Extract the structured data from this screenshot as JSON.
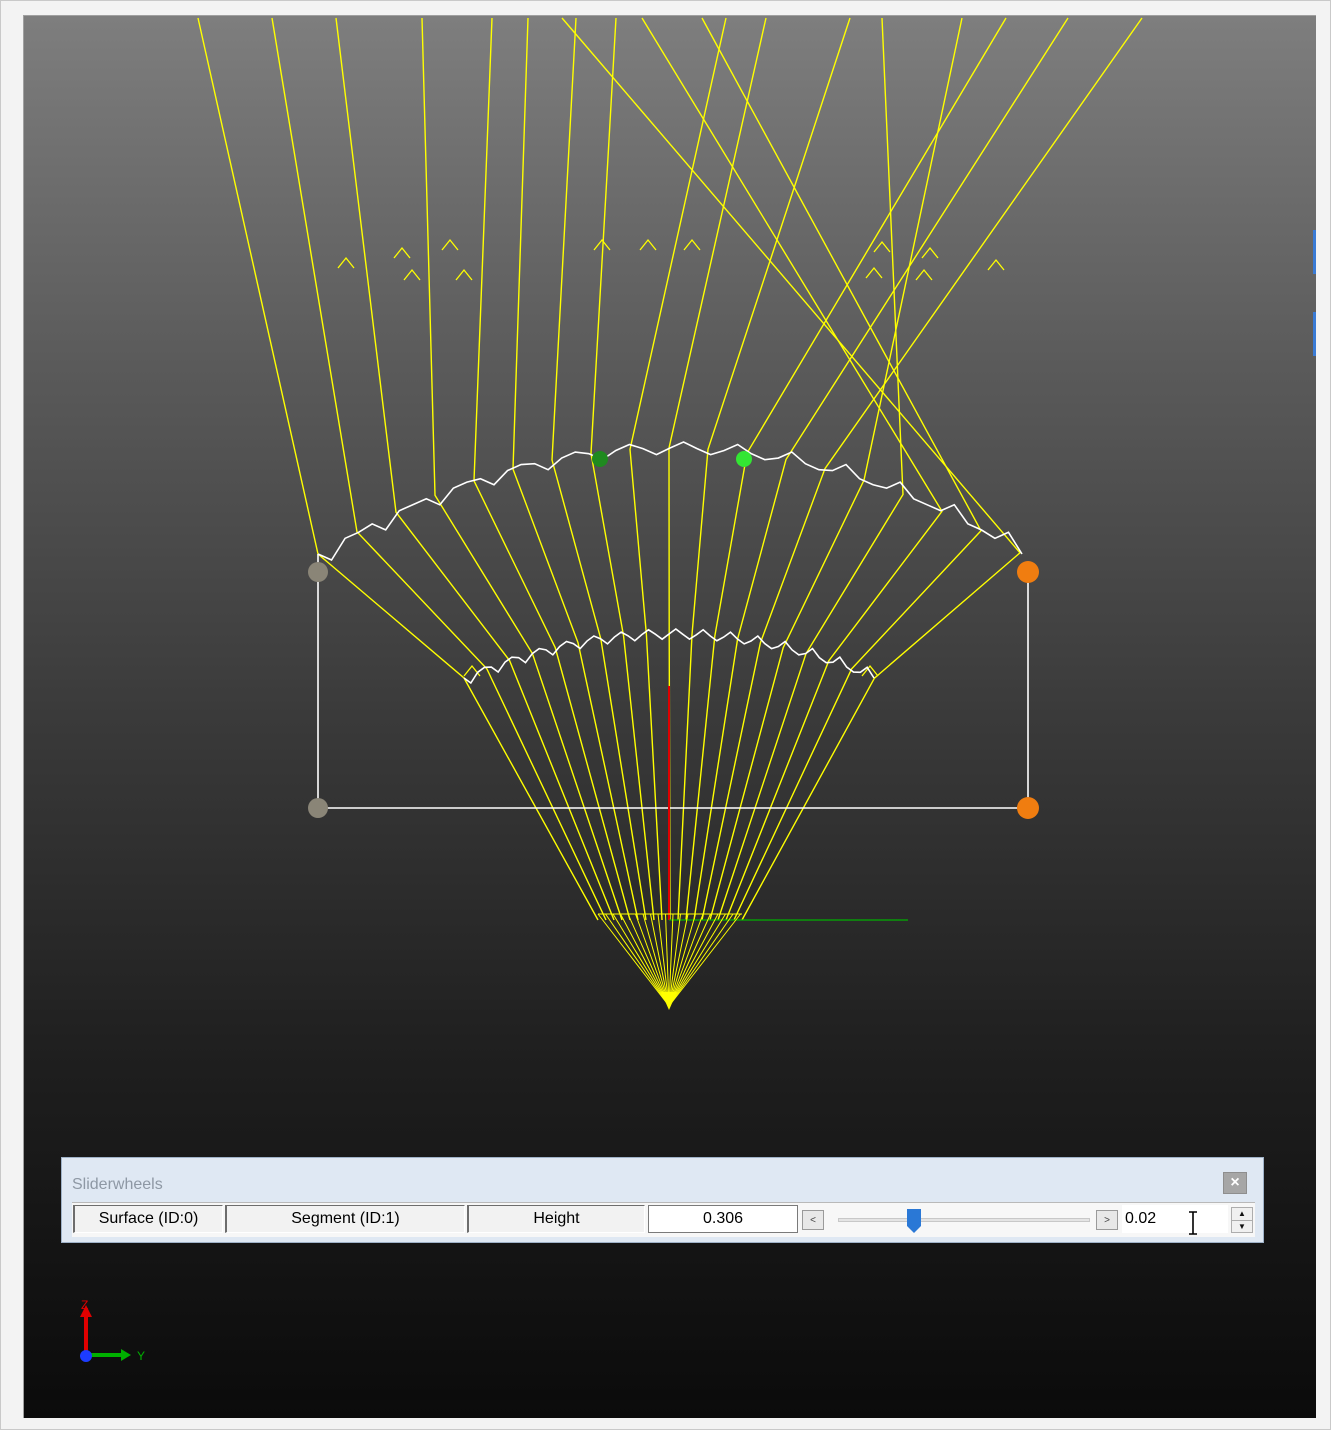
{
  "sliderwheels": {
    "title": "Sliderwheels",
    "close_glyph": "×",
    "surface_label": "Surface (ID:0)",
    "segment_label": "Segment (ID:1)",
    "property_label": "Height",
    "value": "0.306",
    "decrement_glyph": "<",
    "increment_glyph": ">",
    "slider_level": 0.3,
    "step_value": "0.02",
    "spin_up_glyph": "▲",
    "spin_down_glyph": "▼"
  },
  "axes": {
    "z_label": "Z",
    "y_label": "Y"
  },
  "colors": {
    "ray": "#ffff00",
    "outline": "#ffffff",
    "z_axis": "#ff0000",
    "y_axis": "#00c000",
    "handle_orange": "#f07d10",
    "handle_grey": "#8a8577",
    "handle_green_dark": "#1f8a1f",
    "handle_green_light": "#33e633",
    "accent_blue": "#2a78d6"
  },
  "icons": {
    "close": "close-icon",
    "text_cursor": "text-cursor-icon",
    "spin": "spin-arrows-icon"
  }
}
